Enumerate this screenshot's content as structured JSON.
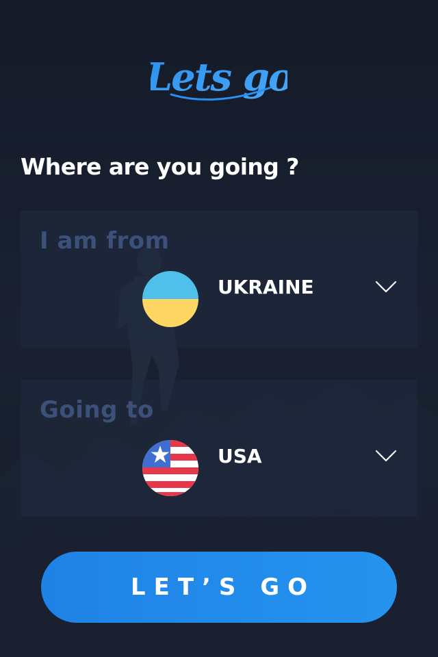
{
  "app": {
    "logo_text": "Lets go",
    "accent_color": "#2a8ff0",
    "background_color": "#161c2a"
  },
  "heading": "Where are you going ?",
  "from": {
    "label": "I am from",
    "country": "UKRAINE",
    "flag_icon": "ukraine-flag",
    "flag_colors": [
      "#4fc0ea",
      "#fdd663"
    ]
  },
  "to": {
    "label": "Going to",
    "country": "USA",
    "flag_icon": "usa-flag",
    "flag_colors": [
      "#3f6fd0",
      "#e6384a",
      "#ffffff"
    ]
  },
  "cta": {
    "label": "LET’S GO"
  }
}
